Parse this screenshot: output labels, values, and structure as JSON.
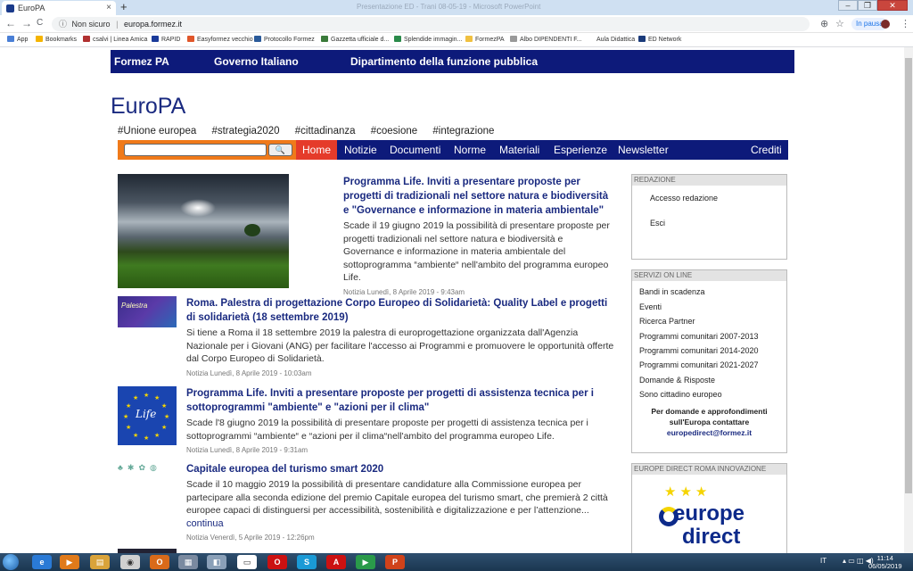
{
  "browser": {
    "tab_title": "EuroPA",
    "tab_close": "×",
    "new_tab": "+",
    "background_window_title": "Presentazione ED - Trani 08-05-19 - Microsoft PowerPoint",
    "window_controls": {
      "minimize": "–",
      "maximize": "❐",
      "close": "✕"
    },
    "nav": {
      "back": "←",
      "forward": "→",
      "reload": "C"
    },
    "security_label": "Non sicuro",
    "url": "europa.formez.it",
    "profile_status": "In pausa",
    "bookmarks": [
      {
        "label": "App",
        "color": "#4a7fd6"
      },
      {
        "label": "Bookmarks",
        "color": "#f5b400"
      },
      {
        "label": "csalvi | Linea Amica",
        "color": "#b03030"
      },
      {
        "label": "RAPID",
        "color": "#1a3a9a"
      },
      {
        "label": "Easyformez vecchio",
        "color": "#e0562a"
      },
      {
        "label": "Protocollo Formez",
        "color": "#2a5a9a"
      },
      {
        "label": "Gazzetta ufficiale d...",
        "color": "#3a7a3a"
      },
      {
        "label": "Splendide immagin...",
        "color": "#2a8a4a"
      },
      {
        "label": "FormezPA",
        "color": "#f0c040"
      },
      {
        "label": "Albo DIPENDENTI F...",
        "color": "#999999"
      },
      {
        "label": "Aula Didattica",
        "color": "#ffffff"
      },
      {
        "label": "ED Network",
        "color": "#1a3a7a"
      }
    ]
  },
  "site": {
    "topbar": [
      "Formez PA",
      "Governo Italiano",
      "Dipartimento della funzione pubblica"
    ],
    "title": "EuroPA",
    "hashtags": [
      "#Unione europea",
      "#strategia2020",
      "#cittadinanza",
      "#coesione",
      "#integrazione"
    ],
    "search": {
      "button_label": "🔍",
      "value": ""
    },
    "nav": [
      "Home",
      "Notizie",
      "Documenti",
      "Norme",
      "Materiali",
      "Esperienze",
      "Newsletter",
      "Crediti"
    ],
    "colors": {
      "brand_blue": "#0d1a7a",
      "accent_orange": "#f07a1a",
      "active_red": "#e53b2a",
      "title_blue": "#1a2a80"
    }
  },
  "articles": [
    {
      "title": "Programma Life. Inviti a presentare proposte per progetti di tradizionali nel settore natura e biodiversità e \"Governance e informazione in materia ambientale\"",
      "summary": "Scade il 19 giugno 2019 la possibilità di presentare proposte per progetti tradizionali nel settore natura e biodiversità e Governance e informazione in materia ambientale del sottoprogramma “ambiente“ nell'ambito del programma europeo Life.",
      "meta": "Notizia Lunedì, 8 Aprile 2019 - 9:43am"
    },
    {
      "title": "Roma. Palestra di progettazione Corpo Europeo di Solidarietà: Quality Label e progetti di solidarietà (18 settembre 2019)",
      "summary": "Si tiene a Roma il 18 settembre 2019 la palestra di europrogettazione organizzata dall'Agenzia Nazionale per i Giovani (ANG) per facilitare l'accesso ai Programmi e promuovere le opportunità offerte dal Corpo Europeo di Solidarietà.",
      "meta": "Notizia Lunedì, 8 Aprile 2019 - 10:03am",
      "thumb_text": "Palestra"
    },
    {
      "title": "Programma Life. Inviti a presentare proposte per progetti di assistenza tecnica per i sottoprogrammi \"ambiente\" e \"azioni per il clima\"",
      "summary": "Scade l'8 giugno 2019 la possibilità di presentare proposte per progetti di assistenza tecnica per i sottoprogrammi “ambiente“ e “azioni per il clima“nell'ambito del programma europeo Life.",
      "meta": "Notizia Lunedì, 8 Aprile 2019 - 9:31am",
      "thumb_text": "Life"
    },
    {
      "title": "Capitale europea del turismo smart 2020",
      "summary": "Scade il 10 maggio 2019 la possibilità di presentare candidature alla Commissione europea per partecipare alla seconda edizione del premio Capitale europea del turismo smart, che premierà 2 città europee capaci di distinguersi per accessibilità, sostenibilità e digitalizzazione e per l’attenzione...",
      "more": "continua",
      "meta": "Notizia Venerdì, 5 Aprile 2019 - 12:26pm"
    }
  ],
  "sidebar": {
    "redazione": {
      "title": "REDAZIONE",
      "links": [
        "Accesso redazione",
        "Esci"
      ]
    },
    "servizi": {
      "title": "SERVIZI ON LINE",
      "links": [
        "Bandi in scadenza",
        "Eventi",
        "Ricerca Partner",
        "Programmi comunitari 2007-2013",
        "Programmi comunitari 2014-2020",
        "Programmi comunitari 2021-2027",
        "Domande & Risposte",
        "Sono cittadino europeo"
      ],
      "contact_line1": "Per domande e approfondimenti",
      "contact_line2": "sull'Europa contattare",
      "contact_email": "europedirect@formez.it"
    },
    "europe_direct": {
      "title": "EUROPE DIRECT ROMA INNOVAZIONE",
      "logo_line1": "europe",
      "logo_line2": "direct"
    }
  },
  "taskbar": {
    "apps": [
      {
        "label": "e",
        "color": "#2a7ad6"
      },
      {
        "label": "▶",
        "color": "#e07a1a"
      },
      {
        "label": "▤",
        "color": "#d9a33a"
      },
      {
        "label": "◉",
        "color": "#d0d0d0"
      },
      {
        "label": "O",
        "color": "#d96a1a"
      },
      {
        "label": "▦",
        "color": "#7a8aa0"
      },
      {
        "label": "◧",
        "color": "#8aa0b8"
      },
      {
        "label": "▭",
        "color": "#ffffff"
      },
      {
        "label": "O",
        "color": "#cc1111"
      },
      {
        "label": "S",
        "color": "#1a9ad6"
      },
      {
        "label": "A",
        "color": "#cc1111"
      },
      {
        "label": "▶",
        "color": "#2a9a4a"
      },
      {
        "label": "▣",
        "color": "#aaaaaa"
      },
      {
        "label": "P",
        "color": "#d0421a"
      }
    ],
    "language": "IT",
    "time": "11:14",
    "date": "06/05/2019"
  }
}
